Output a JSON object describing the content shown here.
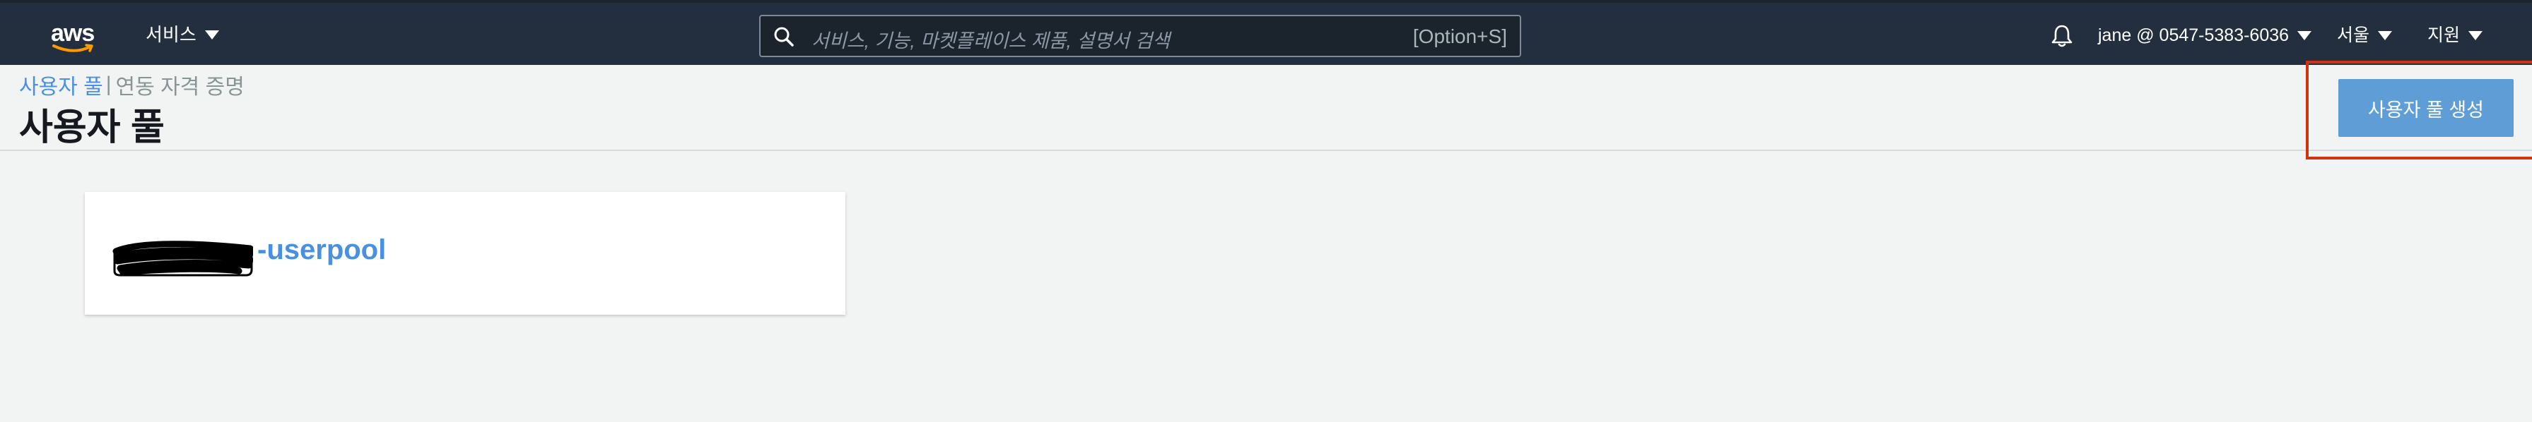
{
  "topnav": {
    "logo_text": "aws",
    "services_label": "서비스",
    "search": {
      "placeholder": "서비스, 기능, 마켓플레이스 제품, 설명서 검색",
      "shortcut": "[Option+S]"
    },
    "account_label": "jane @ 0547-5383-6036",
    "region_label": "서울",
    "support_label": "지원"
  },
  "breadcrumb": {
    "link": "사용자 풀",
    "separator": "|",
    "current": "연동 자격 증명"
  },
  "page_title": "사용자 풀",
  "create_button_label": "사용자 풀 생성",
  "user_pools": [
    {
      "name_visible_suffix": "-userpool"
    }
  ],
  "colors": {
    "topnav_bg": "#232f3e",
    "link": "#4a90e2",
    "primary_button": "#5e9dd6",
    "highlight": "#d13212"
  }
}
